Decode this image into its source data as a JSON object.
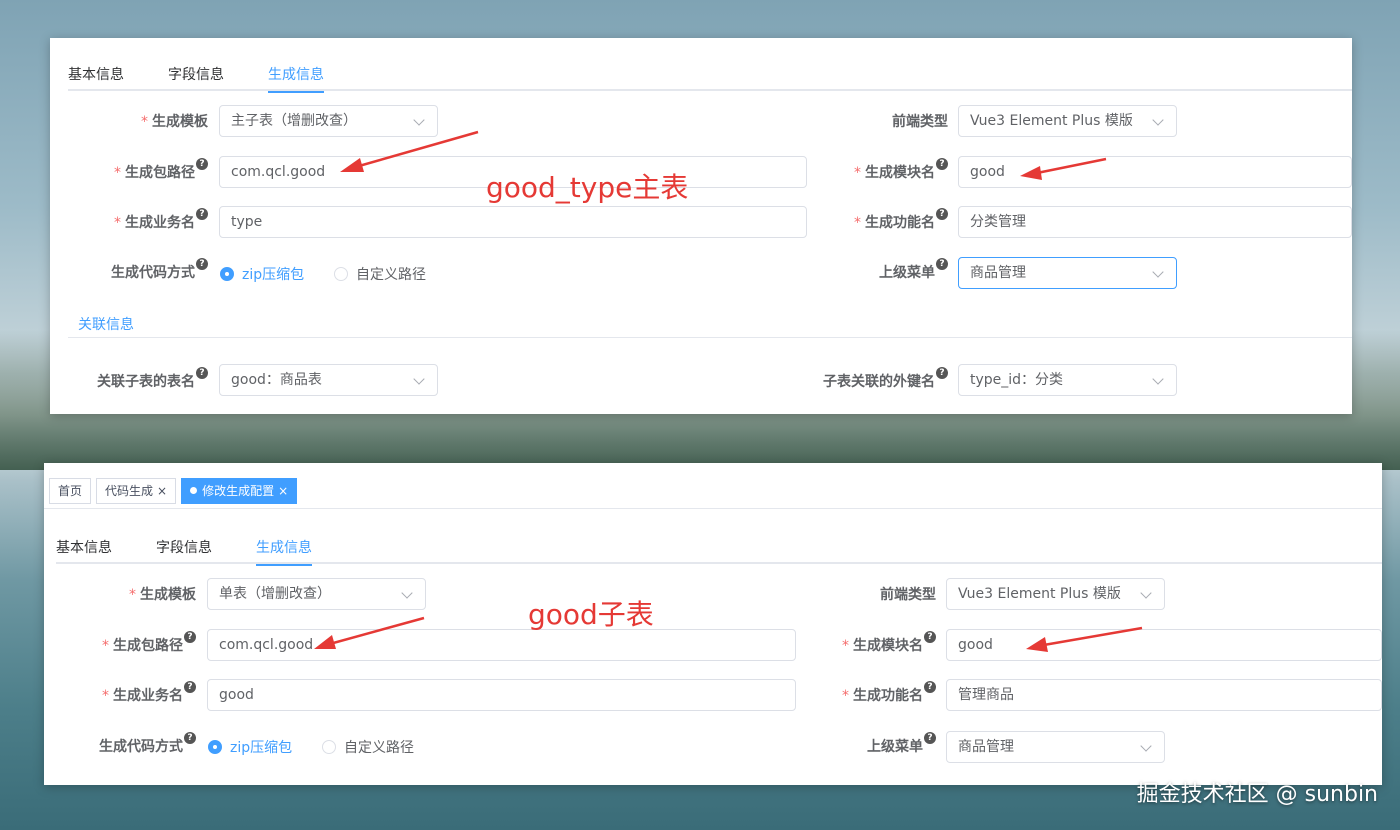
{
  "top": {
    "tabs": [
      "基本信息",
      "字段信息",
      "生成信息"
    ],
    "active_tab": 2,
    "fields": {
      "template_label": "生成模板",
      "template_value": "主子表（增删改查）",
      "package_label": "生成包路径",
      "package_value": "com.qcl.good",
      "business_label": "生成业务名",
      "business_value": "type",
      "method_label": "生成代码方式",
      "radio_zip": "zip压缩包",
      "radio_custom": "自定义路径",
      "frontend_label": "前端类型",
      "frontend_value": "Vue3 Element Plus 模版",
      "module_label": "生成模块名",
      "module_value": "good",
      "function_label": "生成功能名",
      "function_value": "分类管理",
      "menu_label": "上级菜单",
      "menu_value": "商品管理"
    },
    "relation_section": "关联信息",
    "sub_table_label": "关联子表的表名",
    "sub_table_value": "good：商品表",
    "fk_label": "子表关联的外键名",
    "fk_value": "type_id：分类",
    "annotation": "good_type主表"
  },
  "bottom": {
    "nav_tabs": [
      "首页",
      "代码生成",
      "修改生成配置"
    ],
    "tabs": [
      "基本信息",
      "字段信息",
      "生成信息"
    ],
    "active_tab": 2,
    "fields": {
      "template_label": "生成模板",
      "template_value": "单表（增删改查）",
      "package_label": "生成包路径",
      "package_value": "com.qcl.good",
      "business_label": "生成业务名",
      "business_value": "good",
      "method_label": "生成代码方式",
      "radio_zip": "zip压缩包",
      "radio_custom": "自定义路径",
      "frontend_label": "前端类型",
      "frontend_value": "Vue3 Element Plus 模版",
      "module_label": "生成模块名",
      "module_value": "good",
      "function_label": "生成功能名",
      "function_value": "管理商品",
      "menu_label": "上级菜单",
      "menu_value": "商品管理"
    },
    "annotation": "good子表"
  },
  "watermark": "掘金技术社区 @ sunbin",
  "colors": {
    "accent": "#409eff",
    "required": "#f56c6c",
    "annotation": "#e53935"
  }
}
